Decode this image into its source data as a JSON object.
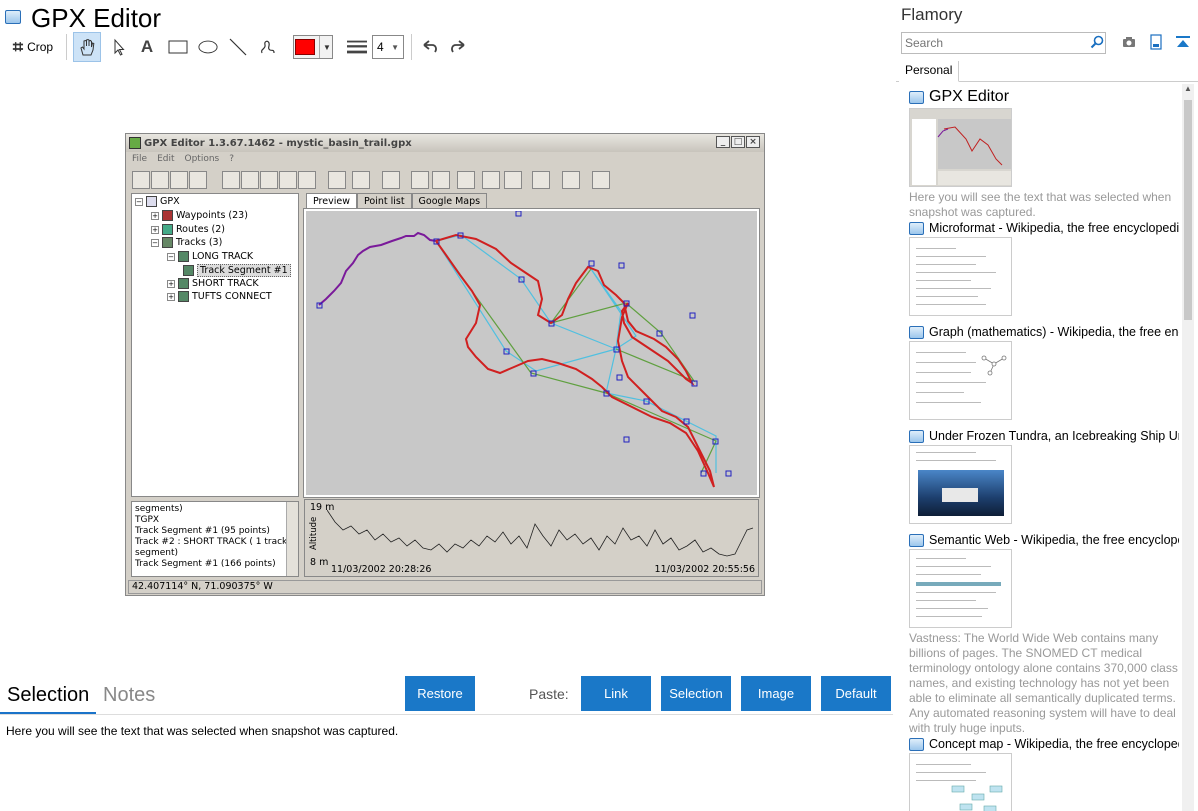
{
  "app": {
    "title": "GPX Editor"
  },
  "toolbar": {
    "crop_label": "Crop",
    "tools": [
      "hand-icon",
      "pointer-icon",
      "text-icon",
      "rectangle-icon",
      "ellipse-icon",
      "line-icon",
      "freehand-icon"
    ],
    "stroke_color": "#ff0000",
    "line_width": "4"
  },
  "screenshot": {
    "window_title": "GPX Editor 1.3.67.1462 - mystic_basin_trail.gpx",
    "menu": [
      "File",
      "Edit",
      "Options",
      "?"
    ],
    "tree": [
      "GPX",
      "Waypoints (23)",
      "Routes (2)",
      "Tracks (3)",
      "LONG TRACK",
      "Track Segment #1",
      "SHORT TRACK",
      "TUFTS CONNECT"
    ],
    "log": [
      "segments)",
      "TGPX",
      "Track Segment #1 (95 points)",
      "Track #2 : SHORT TRACK ( 1 track",
      "segment)",
      "Track Segment #1 (166 points)"
    ],
    "tabs": [
      "Preview",
      "Point list",
      "Google Maps"
    ],
    "profile": {
      "max_label": "19 m",
      "min_label": "8 m",
      "axis_label": "Altitude",
      "start_time": "11/03/2002 20:28:26",
      "end_time": "11/03/2002 20:55:56"
    },
    "status": "42.407114° N, 71.090375° W"
  },
  "bottom": {
    "tabs": {
      "selection": "Selection",
      "notes": "Notes"
    },
    "restore_label": "Restore",
    "paste_label": "Paste:",
    "paste_buttons": {
      "link": "Link",
      "selection": "Selection",
      "image": "Image",
      "default": "Default"
    },
    "selection_text": "Here you will see the text that was selected when snapshot was captured."
  },
  "sidebar": {
    "title": "Flamory",
    "search_placeholder": "Search",
    "tab": "Personal",
    "entries": [
      {
        "title": "GPX Editor",
        "desc": "Here you will see the text that was selected when snapshot was captured."
      },
      {
        "title": "Microformat - Wikipedia, the free encyclopedia",
        "desc": ""
      },
      {
        "title": "Graph (mathematics) - Wikipedia, the free encyclopedia",
        "desc": ""
      },
      {
        "title": "Under Frozen Tundra, an Icebreaking Ship Uncovers",
        "desc": ""
      },
      {
        "title": "Semantic Web - Wikipedia, the free encyclopedia",
        "desc": "Vastness: The World Wide Web contains many billions of pages. The SNOMED CT medical terminology ontology alone contains 370,000 class names, and existing technology has not yet been able to eliminate all semantically duplicated terms. Any automated reasoning system will have to deal with truly huge inputs."
      },
      {
        "title": "Concept map - Wikipedia, the free encyclopedia",
        "desc": ""
      }
    ]
  }
}
